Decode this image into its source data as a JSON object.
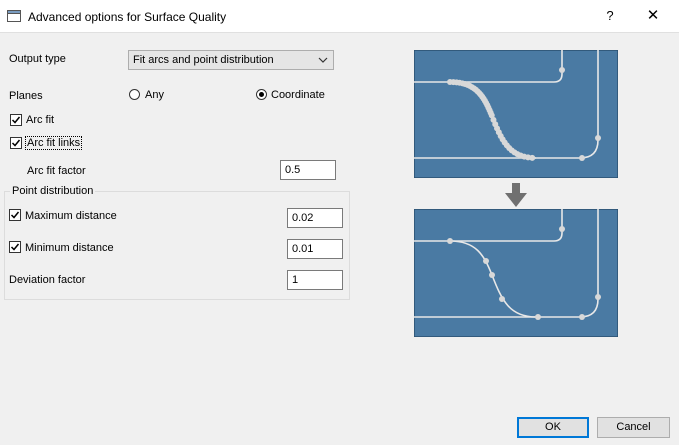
{
  "window": {
    "title": "Advanced options for Surface Quality",
    "help_label": "?",
    "close_label": "✕"
  },
  "output_type": {
    "label": "Output type",
    "selected": "Fit arcs and point distribution"
  },
  "planes": {
    "label": "Planes",
    "options": [
      {
        "label": "Any",
        "selected": false
      },
      {
        "label": "Coordinate",
        "selected": true
      }
    ]
  },
  "arc_fit": {
    "label": "Arc fit",
    "checked": true
  },
  "arc_fit_links": {
    "label": "Arc fit links",
    "checked": true
  },
  "arc_fit_factor": {
    "label": "Arc fit factor",
    "value": "0.5"
  },
  "point_distribution": {
    "title": "Point distribution",
    "max_distance": {
      "label": "Maximum distance",
      "checked": true,
      "value": "0.02"
    },
    "min_distance": {
      "label": "Minimum distance",
      "checked": true,
      "value": "0.01"
    },
    "deviation_factor": {
      "label": "Deviation factor",
      "value": "1"
    }
  },
  "buttons": {
    "ok": "OK",
    "cancel": "Cancel"
  },
  "colors": {
    "diagram_bg": "#4a7aa3",
    "diagram_line": "#e8e8e8",
    "accent": "#0078d7"
  }
}
